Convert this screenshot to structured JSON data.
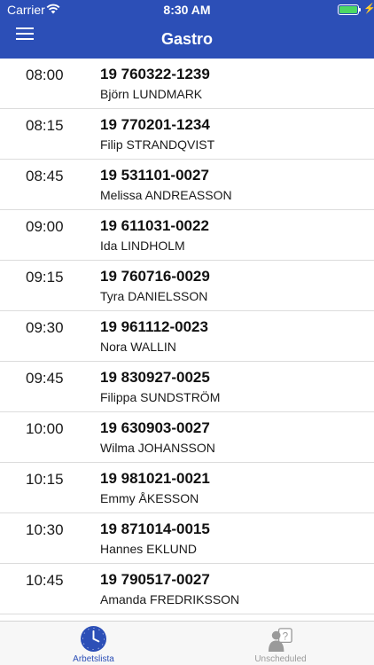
{
  "status_bar": {
    "carrier": "Carrier",
    "time": "8:30 AM"
  },
  "header": {
    "title": "Gastro"
  },
  "appointments": [
    {
      "time": "08:00",
      "id": "19 760322-1239",
      "name": "Björn LUNDMARK"
    },
    {
      "time": "08:15",
      "id": "19 770201-1234",
      "name": "Filip STRANDQVIST"
    },
    {
      "time": "08:45",
      "id": "19 531101-0027",
      "name": "Melissa ANDREASSON"
    },
    {
      "time": "09:00",
      "id": "19 611031-0022",
      "name": "Ida LINDHOLM"
    },
    {
      "time": "09:15",
      "id": "19 760716-0029",
      "name": "Tyra DANIELSSON"
    },
    {
      "time": "09:30",
      "id": "19 961112-0023",
      "name": "Nora WALLIN"
    },
    {
      "time": "09:45",
      "id": "19 830927-0025",
      "name": "Filippa SUNDSTRÖM"
    },
    {
      "time": "10:00",
      "id": "19 630903-0027",
      "name": "Wilma JOHANSSON"
    },
    {
      "time": "10:15",
      "id": "19 981021-0021",
      "name": "Emmy ÅKESSON"
    },
    {
      "time": "10:30",
      "id": "19 871014-0015",
      "name": "Hannes EKLUND"
    },
    {
      "time": "10:45",
      "id": "19 790517-0027",
      "name": "Amanda FREDRIKSSON"
    }
  ],
  "tabs": [
    {
      "label": "Arbetslista",
      "icon": "clock-icon",
      "active": true
    },
    {
      "label": "Unscheduled",
      "icon": "person-question-icon",
      "active": false
    }
  ],
  "colors": {
    "accent": "#2c4fb7",
    "inactive": "#9a9a9a",
    "battery": "#4cd964"
  }
}
